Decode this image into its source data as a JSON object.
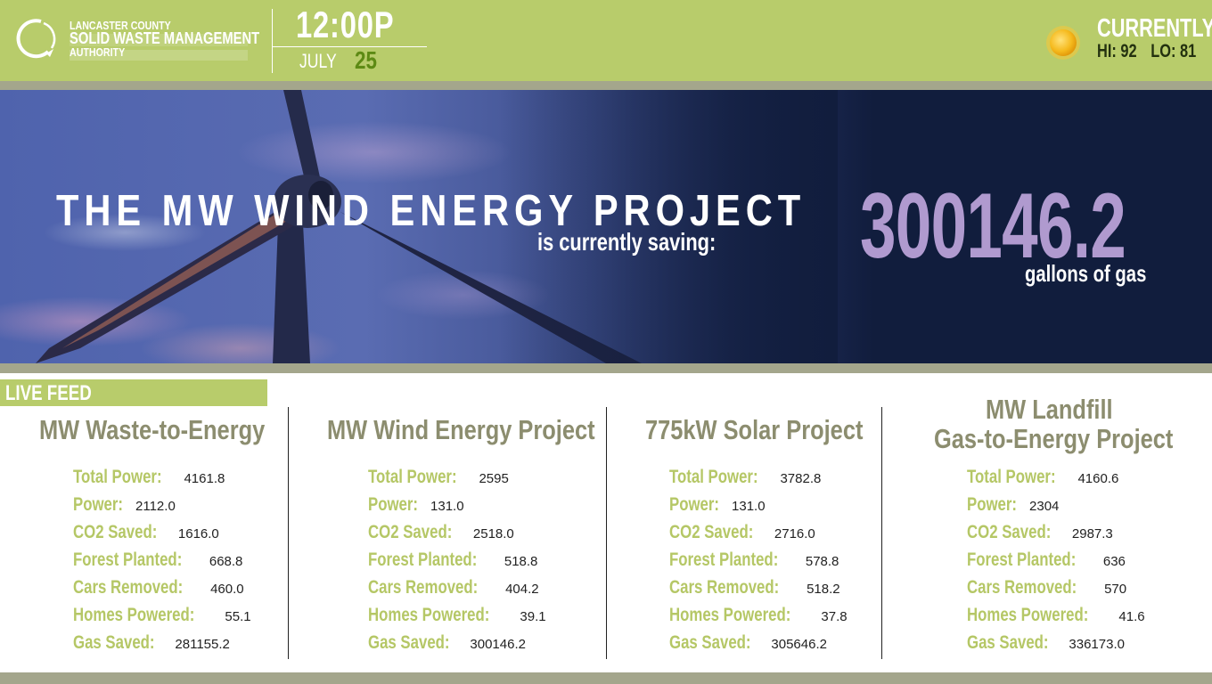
{
  "header": {
    "org_line1": "LANCASTER COUNTY",
    "org_line2": "SOLID WASTE MANAGEMENT",
    "org_line3": "AUTHORITY",
    "time": "12:00P",
    "month": "JULY",
    "day": "25",
    "weather_label": "CURRENTLY",
    "hi": "HI: 92",
    "lo": "LO: 81",
    "weather_icon": "sun-icon"
  },
  "hero": {
    "title": "THE MW WIND ENERGY PROJECT",
    "subtitle": "is currently saving:",
    "value": "300146.2",
    "unit": "gallons of gas"
  },
  "live_feed_label": "LIVE FEED",
  "projects": [
    {
      "title": "MW Waste-to-Energy",
      "stats": [
        {
          "label": "Total Power:",
          "value": "4161.8"
        },
        {
          "label": "Power:",
          "value": "2112.0"
        },
        {
          "label": "CO2 Saved:",
          "value": "1616.0"
        },
        {
          "label": "Forest Planted:",
          "value": "668.8"
        },
        {
          "label": "Cars Removed:",
          "value": "460.0"
        },
        {
          "label": "Homes Powered:",
          "value": "55.1"
        },
        {
          "label": "Gas Saved:",
          "value": "281155.2"
        }
      ]
    },
    {
      "title": "MW Wind Energy Project",
      "stats": [
        {
          "label": "Total Power:",
          "value": "2595"
        },
        {
          "label": "Power:",
          "value": "131.0"
        },
        {
          "label": "CO2 Saved:",
          "value": "2518.0"
        },
        {
          "label": "Forest Planted:",
          "value": "518.8"
        },
        {
          "label": "Cars Removed:",
          "value": "404.2"
        },
        {
          "label": "Homes Powered:",
          "value": "39.1"
        },
        {
          "label": "Gas Saved:",
          "value": "300146.2"
        }
      ]
    },
    {
      "title": "775kW Solar Project",
      "stats": [
        {
          "label": "Total Power:",
          "value": "3782.8"
        },
        {
          "label": "Power:",
          "value": "131.0"
        },
        {
          "label": "CO2 Saved:",
          "value": "2716.0"
        },
        {
          "label": "Forest Planted:",
          "value": "578.8"
        },
        {
          "label": "Cars Removed:",
          "value": "518.2"
        },
        {
          "label": "Homes Powered:",
          "value": "37.8"
        },
        {
          "label": "Gas Saved:",
          "value": "305646.2"
        }
      ]
    },
    {
      "title_line1": "MW Landfill",
      "title_line2": "Gas-to-Energy Project",
      "stats": [
        {
          "label": "Total Power:",
          "value": "4160.6"
        },
        {
          "label": "Power:",
          "value": "2304"
        },
        {
          "label": "CO2 Saved:",
          "value": "2987.3"
        },
        {
          "label": "Forest Planted:",
          "value": "636"
        },
        {
          "label": "Cars Removed:",
          "value": "570"
        },
        {
          "label": "Homes Powered:",
          "value": "41.6"
        },
        {
          "label": "Gas Saved:",
          "value": "336173.0"
        }
      ]
    }
  ],
  "colors": {
    "header_green": "#b8cc6b",
    "separator": "#a4a68c",
    "hero_value": "#b09acf",
    "title_gray": "#8c8d6f",
    "label_green": "#b5c766",
    "day_green": "#5d8a14"
  }
}
